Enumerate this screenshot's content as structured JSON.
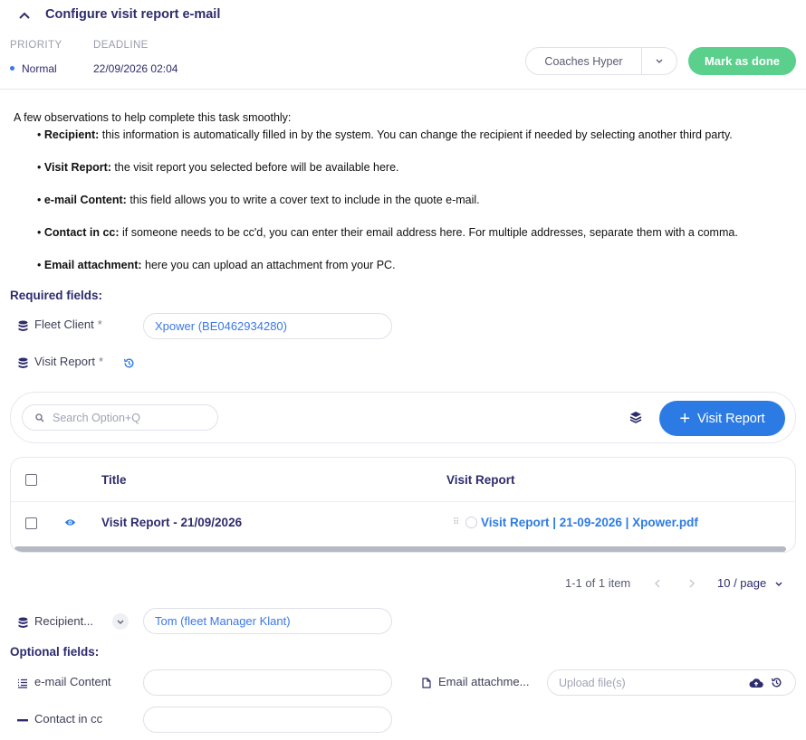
{
  "header": {
    "title": "Configure visit report e-mail",
    "priority_label": "PRIORITY",
    "priority_value": "Normal",
    "deadline_label": "DEADLINE",
    "deadline_value": "22/09/2026 02:04",
    "assignee": "Coaches Hyper",
    "mark_done_label": "Mark as done"
  },
  "instructions": {
    "intro": "A few observations to help complete this task smoothly:",
    "items": [
      {
        "bold": "Recipient:",
        "text": " this information is automatically filled in by the system. You can change the recipient if needed by selecting another third party."
      },
      {
        "bold": "Visit Report:",
        "text": " the visit report you selected before will be available here."
      },
      {
        "bold": "e-mail Content:",
        "text": " this field allows you to write a cover text to include in the quote e-mail."
      },
      {
        "bold": "Contact in cc:",
        "text": " if someone needs to be cc'd, you can enter their email address here. For multiple addresses, separate them with a comma."
      },
      {
        "bold": "Email attachment:",
        "text": " here you can upload an attachment from your PC."
      }
    ]
  },
  "required": {
    "heading": "Required fields:",
    "fleet_client_label": "Fleet Client",
    "required_mark": "*",
    "fleet_client_value": "Xpower (BE0462934280)",
    "visit_report_label": "Visit Report"
  },
  "toolbar": {
    "search_placeholder": "Search Option+Q",
    "add_label": "Visit Report"
  },
  "table": {
    "columns": [
      "Title",
      "Visit Report"
    ],
    "rows": [
      {
        "title": "Visit Report - 21/09/2026",
        "file": "Visit Report | 21-09-2026 | Xpower.pdf"
      }
    ]
  },
  "pagination": {
    "summary": "1-1 of 1 item",
    "page_size": "10 / page"
  },
  "recipient": {
    "label": "Recipient...",
    "value": "Tom (fleet Manager Klant)"
  },
  "optional": {
    "heading": "Optional fields:",
    "email_content_label": "e-mail Content",
    "email_content_value": "",
    "attachment_label": "Email attachme...",
    "upload_placeholder": "Upload file(s)",
    "cc_label": "Contact in cc",
    "cc_value": ""
  },
  "colors": {
    "primary": "#2c7be5",
    "success": "#5bd08c",
    "heading": "#2e2c6d"
  }
}
